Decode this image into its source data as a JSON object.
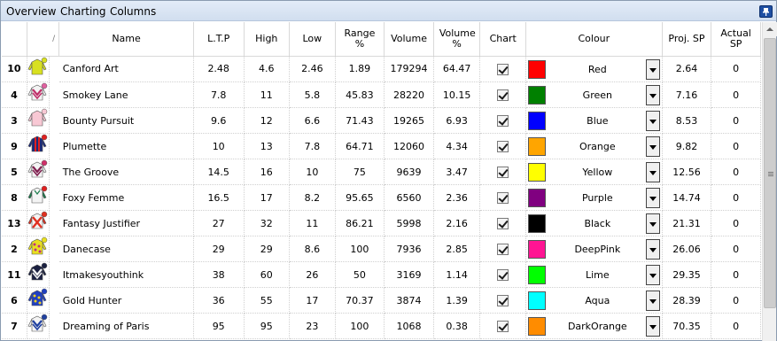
{
  "menu": {
    "items": [
      "Overview",
      "Charting",
      "Columns"
    ]
  },
  "icons": {
    "pin": "pin-icon",
    "sort": "sort-indicator-icon"
  },
  "columns": {
    "num": "",
    "silks": "∕",
    "name": "Name",
    "ltp": "L.T.P",
    "high": "High",
    "low": "Low",
    "range": "Range %",
    "volume": "Volume",
    "volume_pct": "Volume %",
    "chart": "Chart",
    "colour": "Colour",
    "proj_sp": "Proj. SP",
    "actual_sp": "Actual SP"
  },
  "rows": [
    {
      "num": "10",
      "name": "Canford Art",
      "ltp": "2.48",
      "high": "4.6",
      "low": "2.46",
      "range": "1.89",
      "volume": "179294",
      "volume_pct": "64.47",
      "chart": true,
      "colour": "Red",
      "colour_hex": "#ff0000",
      "proj_sp": "2.64",
      "actual_sp": "0",
      "silks": {
        "body": "#d8e020",
        "sleeve": "#d8e020",
        "cap": "#d8e020",
        "accent": "#333333",
        "style": "plain"
      }
    },
    {
      "num": "4",
      "name": "Smokey Lane",
      "ltp": "7.8",
      "high": "11",
      "low": "5.8",
      "range": "45.83",
      "volume": "28220",
      "volume_pct": "10.15",
      "chart": true,
      "colour": "Green",
      "colour_hex": "#008000",
      "proj_sp": "7.16",
      "actual_sp": "0",
      "silks": {
        "body": "#f4f4f4",
        "sleeve": "#f4f4f4",
        "cap": "#e060a0",
        "accent": "#c0306a",
        "style": "chevron"
      }
    },
    {
      "num": "3",
      "name": "Bounty Pursuit",
      "ltp": "9.6",
      "high": "12",
      "low": "6.6",
      "range": "71.43",
      "volume": "19265",
      "volume_pct": "6.93",
      "chart": true,
      "colour": "Blue",
      "colour_hex": "#0000ff",
      "proj_sp": "8.53",
      "actual_sp": "0",
      "silks": {
        "body": "#f8c8d4",
        "sleeve": "#f8c8d4",
        "cap": "#f8c8d4",
        "accent": "#e090a8",
        "style": "plain"
      }
    },
    {
      "num": "9",
      "name": "Plumette",
      "ltp": "10",
      "high": "13",
      "low": "7.8",
      "range": "64.71",
      "volume": "12060",
      "volume_pct": "4.34",
      "chart": true,
      "colour": "Orange",
      "colour_hex": "#ffa500",
      "proj_sp": "9.82",
      "actual_sp": "0",
      "silks": {
        "body": "#1a2a78",
        "sleeve": "#1a2a78",
        "cap": "#e02020",
        "accent": "#e02020",
        "style": "stripes"
      }
    },
    {
      "num": "5",
      "name": "The Groove",
      "ltp": "14.5",
      "high": "16",
      "low": "10",
      "range": "75",
      "volume": "9639",
      "volume_pct": "3.47",
      "chart": true,
      "colour": "Yellow",
      "colour_hex": "#ffff00",
      "proj_sp": "12.56",
      "actual_sp": "0",
      "silks": {
        "body": "#f4f4f4",
        "sleeve": "#f4f4f4",
        "cap": "#d0306a",
        "accent": "#802050",
        "style": "chevron"
      }
    },
    {
      "num": "8",
      "name": "Foxy Femme",
      "ltp": "16.5",
      "high": "17",
      "low": "8.2",
      "range": "95.65",
      "volume": "6560",
      "volume_pct": "2.36",
      "chart": true,
      "colour": "Purple",
      "colour_hex": "#800080",
      "proj_sp": "14.74",
      "actual_sp": "0",
      "silks": {
        "body": "#f4f4f4",
        "sleeve": "#1a7a4a",
        "cap": "#e02020",
        "accent": "#1a7a4a",
        "style": "sleeves"
      }
    },
    {
      "num": "13",
      "name": "Fantasy Justifier",
      "ltp": "27",
      "high": "32",
      "low": "11",
      "range": "86.21",
      "volume": "5998",
      "volume_pct": "2.16",
      "chart": true,
      "colour": "Black",
      "colour_hex": "#000000",
      "proj_sp": "21.31",
      "actual_sp": "0",
      "silks": {
        "body": "#f4f4f4",
        "sleeve": "#e03020",
        "cap": "#e03020",
        "accent": "#e03020",
        "style": "cross"
      }
    },
    {
      "num": "2",
      "name": "Danecase",
      "ltp": "29",
      "high": "29",
      "low": "8.6",
      "range": "100",
      "volume": "7936",
      "volume_pct": "2.85",
      "chart": true,
      "colour": "DeepPink",
      "colour_hex": "#ff1493",
      "proj_sp": "26.06",
      "actual_sp": "0",
      "silks": {
        "body": "#e8e020",
        "sleeve": "#e8e020",
        "cap": "#e8e020",
        "accent": "#c03080",
        "style": "spots"
      }
    },
    {
      "num": "11",
      "name": "Itmakesyouthink",
      "ltp": "38",
      "high": "60",
      "low": "26",
      "range": "50",
      "volume": "3169",
      "volume_pct": "1.14",
      "chart": true,
      "colour": "Lime",
      "colour_hex": "#00ff00",
      "proj_sp": "29.35",
      "actual_sp": "0",
      "silks": {
        "body": "#1a2040",
        "sleeve": "#1a2040",
        "cap": "#1a2040",
        "accent": "#f4f4f4",
        "style": "chevron"
      }
    },
    {
      "num": "6",
      "name": "Gold Hunter",
      "ltp": "36",
      "high": "55",
      "low": "17",
      "range": "70.37",
      "volume": "3874",
      "volume_pct": "1.39",
      "chart": true,
      "colour": "Aqua",
      "colour_hex": "#00ffff",
      "proj_sp": "28.39",
      "actual_sp": "0",
      "silks": {
        "body": "#2040c0",
        "sleeve": "#2040c0",
        "cap": "#2040c0",
        "accent": "#f0d020",
        "style": "spots"
      }
    },
    {
      "num": "7",
      "name": "Dreaming of Paris",
      "ltp": "95",
      "high": "95",
      "low": "23",
      "range": "100",
      "volume": "1068",
      "volume_pct": "0.38",
      "chart": true,
      "colour": "DarkOrange",
      "colour_hex": "#ff8c00",
      "proj_sp": "70.35",
      "actual_sp": "0",
      "silks": {
        "body": "#f4f4f4",
        "sleeve": "#f4f4f4",
        "cap": "#2040a0",
        "accent": "#2040a0",
        "style": "chevron"
      }
    }
  ],
  "scrollbar": {
    "thumb_fraction": 0.95
  }
}
